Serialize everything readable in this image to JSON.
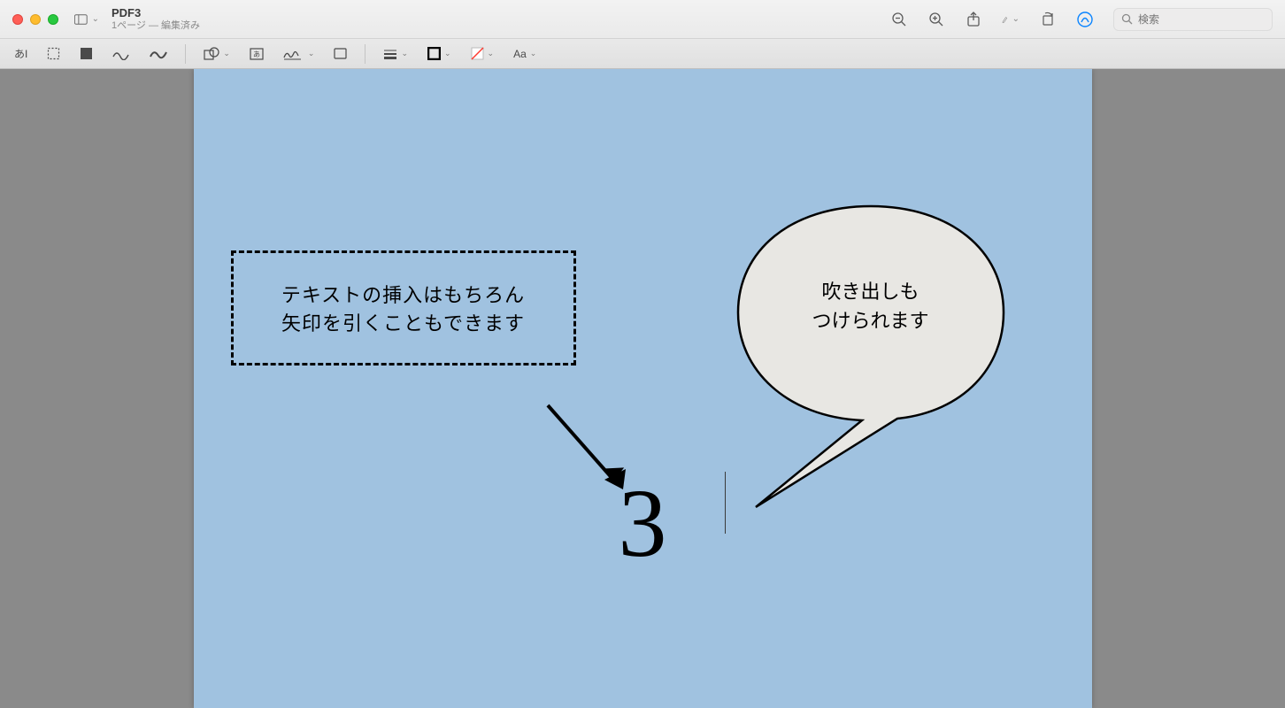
{
  "window": {
    "title": "PDF3",
    "subtitle": "1ページ — 編集済み"
  },
  "search": {
    "placeholder": "検索"
  },
  "toolbar": {
    "text_insert": "あI",
    "font_style": "Aa"
  },
  "page": {
    "dashed_box": {
      "line1": "テキストの挿入はもちろん",
      "line2": "矢印を引くこともできます"
    },
    "bubble": {
      "line1": "吹き出しも",
      "line2": "つけられます"
    },
    "big_number": "3"
  }
}
